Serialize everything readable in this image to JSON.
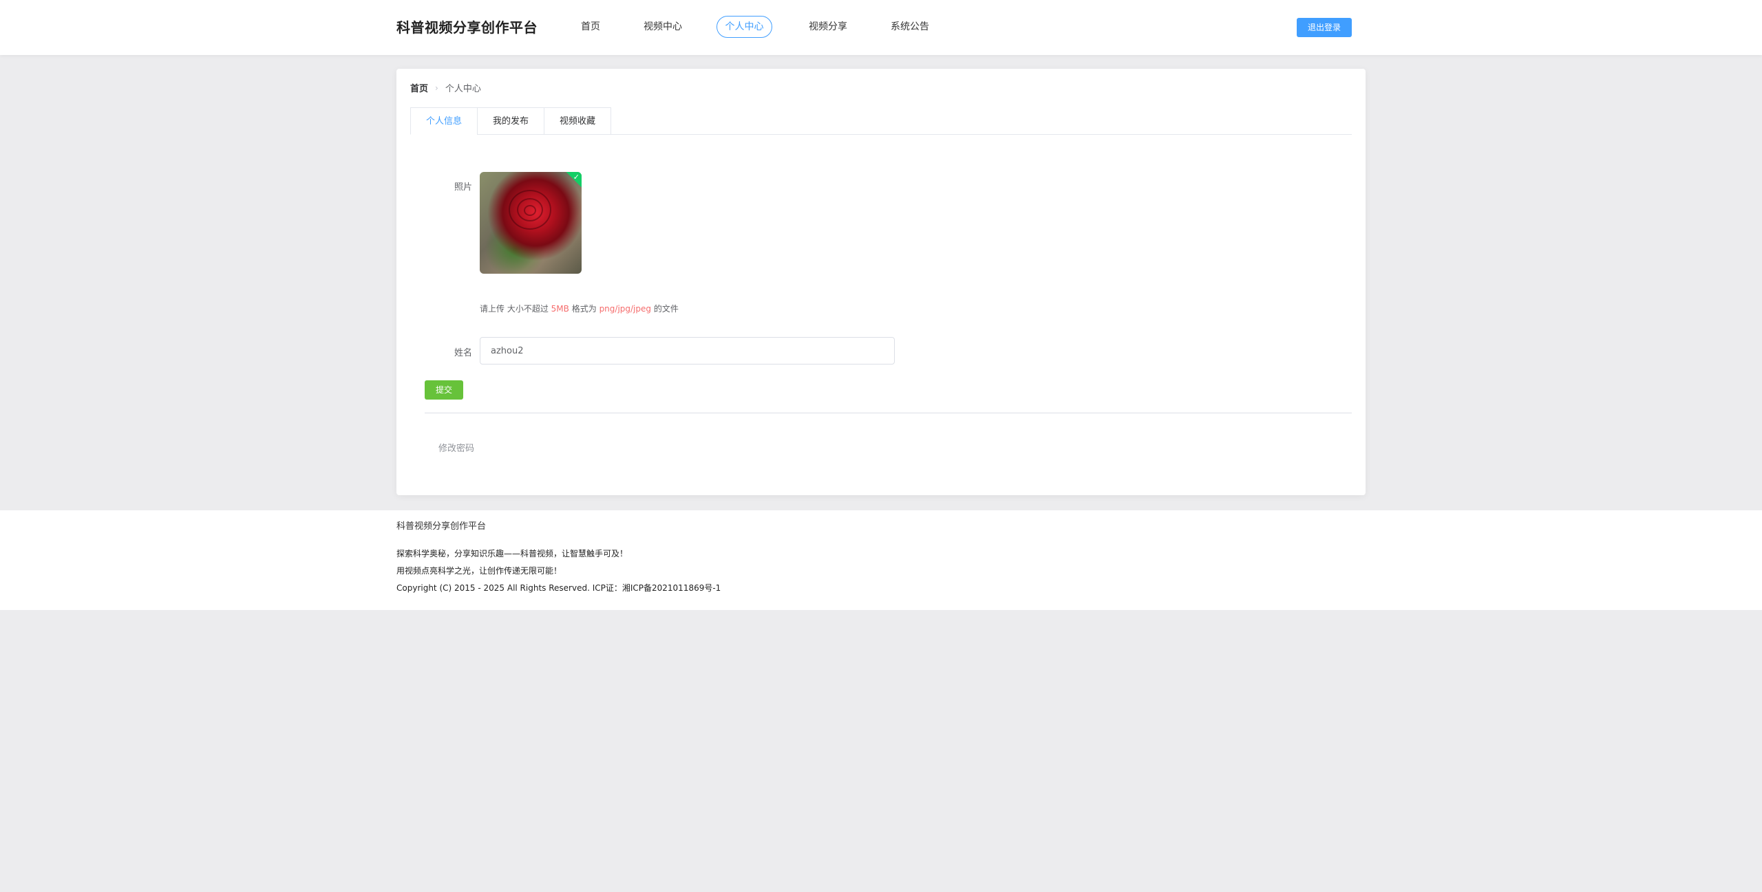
{
  "header": {
    "brand": "科普视频分享创作平台",
    "nav": [
      "首页",
      "视频中心",
      "个人中心",
      "视频分享",
      "系统公告"
    ],
    "active_nav": "个人中心",
    "logout_label": "退出登录",
    "accent_color": "#409eff"
  },
  "breadcrumb": {
    "home": "首页",
    "separator": "›",
    "current": "个人中心"
  },
  "tabs": [
    "个人信息",
    "我的发布",
    "视频收藏"
  ],
  "active_tab": "个人信息",
  "form": {
    "photo_label": "照片",
    "photo_badge": "✓",
    "hint_prefix": "请上传 大小不超过",
    "hint_size": "5MB",
    "hint_mid": "格式为",
    "hint_formats": "png/jpg/jpeg",
    "hint_suffix": "的文件",
    "name_label": "姓名",
    "name_value": "azhou2",
    "submit_label": "提交",
    "submit_color": "#67c23a",
    "change_password": "修改密码"
  },
  "footer": {
    "title": "科普视频分享创作平台",
    "line1": "探索科学奥秘，分享知识乐趣——科普视频，让智慧触手可及！",
    "line2": "用视频点亮科学之光，让创作传递无限可能！",
    "copyright": "Copyright (C) 2015 - 2025 All Rights Reserved. ICP证：湘ICP备2021011869号-1"
  }
}
